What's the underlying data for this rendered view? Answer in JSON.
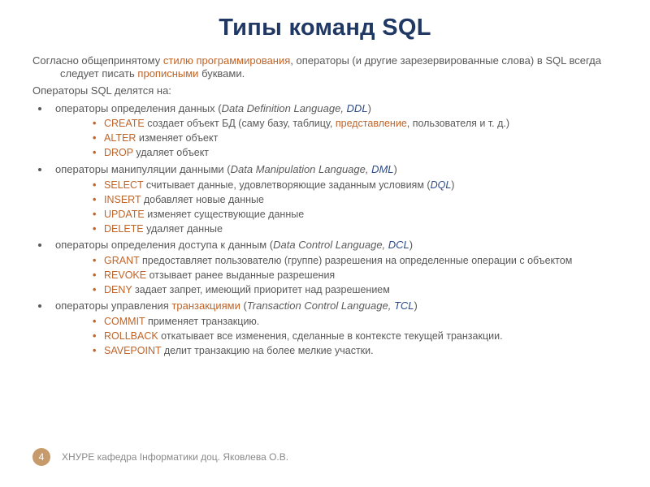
{
  "title": "Типы команд SQL",
  "intro_before_link1": "Согласно общепринятому ",
  "intro_link1": "стилю программирования",
  "intro_mid": ", операторы (и другие зарезервированные слова) в SQL всегда следует писать ",
  "intro_link2": "прописными",
  "intro_after": " буквами.",
  "divide_text": "Операторы SQL делятся на:",
  "groups": [
    {
      "lead": "операторы определения данных (",
      "en": "Data Definition Language, ",
      "acr": "DDL",
      "items": [
        {
          "kw": "CREATE",
          "txt": " создает объект БД (саму базу, таблицу, ",
          "link": "представление",
          "tail": ", пользователя и т. д.)"
        },
        {
          "kw": "ALTER",
          "txt": " изменяет объект"
        },
        {
          "kw": "DROP",
          "txt": " удаляет объект"
        }
      ]
    },
    {
      "lead": "операторы манипуляции данными (",
      "en": "Data Manipulation Language, ",
      "acr": "DML",
      "items": [
        {
          "kw": "SELECT",
          "txt": " считывает данные, удовлетворяющие заданным условиям (",
          "link": "DQL",
          "tail": ")"
        },
        {
          "kw": "INSERT",
          "txt": " добавляет новые данные"
        },
        {
          "kw": "UPDATE",
          "txt": " изменяет существующие данные"
        },
        {
          "kw": "DELETE",
          "txt": " удаляет данные"
        }
      ]
    },
    {
      "lead": "операторы определения доступа к данным (",
      "en": "Data Control Language, ",
      "acr": "DCL",
      "items": [
        {
          "kw": "GRANT",
          "txt": " предоставляет пользователю (группе) разрешения на определенные операции с объектом"
        },
        {
          "kw": "REVOKE",
          "txt": " отзывает ранее выданные разрешения"
        },
        {
          "kw": "DENY",
          "txt": " задает запрет, имеющий приоритет над разрешением"
        }
      ]
    },
    {
      "lead": "операторы управления ",
      "lead_link": "транзакциями",
      "lead_tail": " (",
      "en": "Transaction Control Language, ",
      "acr": "TCL",
      "items": [
        {
          "kw": "COMMIT",
          "txt": " применяет транзакцию."
        },
        {
          "kw": "ROLLBACK",
          "txt": " откатывает все изменения, сделанные в контексте текущей транзакции."
        },
        {
          "kw": "SAVEPOINT",
          "txt": " делит транзакцию на более мелкие участки."
        }
      ]
    }
  ],
  "footer": {
    "page": "4",
    "text": "ХНУРЕ кафедра Інформатики доц. Яковлева О.В."
  }
}
